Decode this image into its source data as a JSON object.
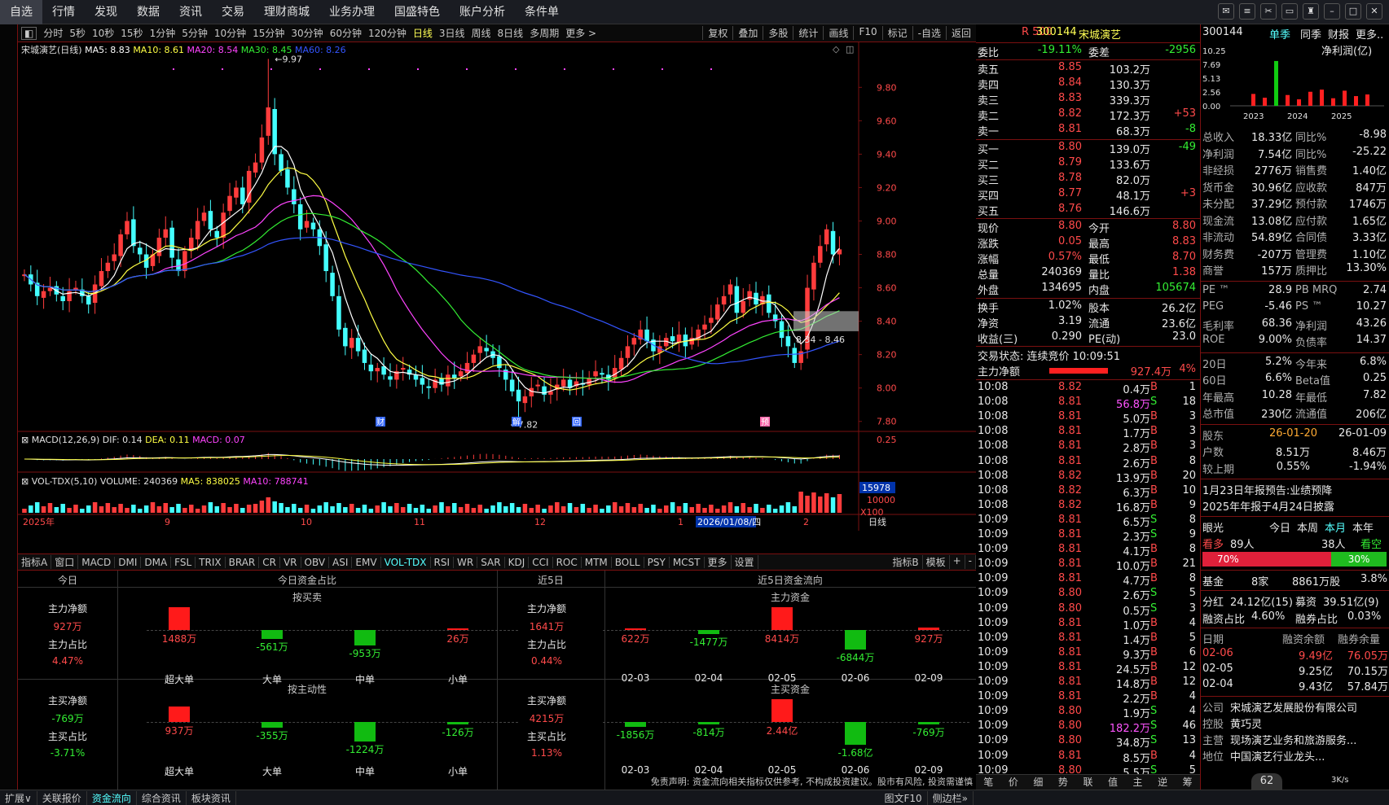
{
  "menu": [
    "自选",
    "行情",
    "发现",
    "数据",
    "资讯",
    "交易",
    "理财商城",
    "业务办理",
    "国盛特色",
    "账户分析",
    "条件单"
  ],
  "periods": [
    "分时",
    "5秒",
    "10秒",
    "15秒",
    "1分钟",
    "5分钟",
    "10分钟",
    "15分钟",
    "30分钟",
    "60分钟",
    "120分钟",
    "日线",
    "3日线",
    "周线",
    "8日线",
    "多周期",
    "更多 >"
  ],
  "period_active": "日线",
  "chart_tools": [
    "复权",
    "叠加",
    "多股",
    "统计",
    "画线",
    "F10",
    "标记",
    "-自选",
    "返回"
  ],
  "stock": {
    "code": "300144",
    "name": "宋城演艺",
    "chart_title": "宋城演艺(日线)",
    "market_tag": "R 500"
  },
  "ma": {
    "ma5": "MA5: 8.83",
    "ma10": "MA10: 8.61",
    "ma20": "MA20: 8.54",
    "ma30": "MA30: 8.45",
    "ma60": "MA60: 8.26"
  },
  "macd_label": {
    "name": "MACD(12,26,9)",
    "dif": "DIF: 0.14",
    "dea": "DEA: 0.11",
    "macd": "MACD: 0.07"
  },
  "vol_label": {
    "name": "VOL-TDX(5,10)",
    "volume": "VOLUME: 240369",
    "ma5": "MA5: 838025",
    "ma10": "MA10: 788741"
  },
  "annotations": {
    "high": "9.97",
    "low": "7.82",
    "range": "8.34 - 8.46",
    "cai": "财",
    "jie": "解",
    "hui": "回",
    "yu": "预"
  },
  "chart_data": {
    "type": "candlestick",
    "y_ticks": [
      "9.80",
      "9.60",
      "9.40",
      "9.20",
      "9.00",
      "8.80",
      "8.60",
      "8.40",
      "8.20",
      "8.00",
      "7.80"
    ],
    "macd_tick": "0.25",
    "vol_ticks": [
      "15978",
      "10000"
    ],
    "vol_unit": "X100",
    "x_labels": [
      "2025年",
      "9",
      "10",
      "11",
      "12",
      "1",
      "2026/01/08/四",
      "2"
    ],
    "x_unit": "日线",
    "ylim": [
      7.75,
      10.05
    ],
    "closes": [
      8.68,
      8.62,
      8.55,
      8.58,
      8.6,
      8.56,
      8.52,
      8.58,
      8.6,
      8.55,
      8.5,
      8.62,
      8.7,
      8.75,
      8.8,
      8.92,
      9.0,
      8.85,
      8.8,
      8.72,
      8.8,
      8.9,
      8.95,
      8.78,
      8.7,
      8.82,
      8.9,
      9.0,
      9.05,
      8.95,
      8.9,
      9.05,
      9.15,
      9.2,
      9.1,
      9.3,
      9.35,
      9.5,
      9.68,
      9.4,
      9.3,
      9.2,
      9.1,
      8.95,
      9.0,
      8.95,
      8.85,
      8.7,
      8.55,
      8.35,
      8.25,
      8.3,
      8.22,
      8.15,
      8.1,
      8.12,
      8.08,
      8.05,
      8.1,
      8.12,
      8.08,
      8.05,
      8.02,
      8.0,
      8.05,
      8.02,
      8.08,
      8.06,
      8.1,
      8.15,
      8.2,
      8.25,
      8.22,
      8.18,
      8.12,
      8.05,
      7.98,
      7.92,
      7.95,
      8.0,
      8.02,
      7.96,
      7.98,
      8.02,
      8.05,
      8.0,
      8.04,
      8.02,
      8.06,
      8.1,
      8.08,
      8.05,
      8.12,
      8.18,
      8.25,
      8.3,
      8.35,
      8.28,
      8.22,
      8.25,
      8.3,
      8.28,
      8.32,
      8.25,
      8.3,
      8.35,
      8.38,
      8.42,
      8.5,
      8.55,
      8.62,
      8.45,
      8.52,
      8.58,
      8.5,
      8.55,
      8.45,
      8.4,
      8.3,
      8.25,
      8.15,
      8.22,
      8.6,
      8.75,
      8.85,
      8.95,
      8.8,
      8.83
    ]
  },
  "quote": {
    "weibi_label": "委比",
    "weibi": "-19.11%",
    "weicha_label": "委差",
    "weicha": "-2956",
    "sells": [
      {
        "label": "卖五",
        "p": "8.85",
        "v": "103.2万",
        "d": ""
      },
      {
        "label": "卖四",
        "p": "8.84",
        "v": "130.3万",
        "d": ""
      },
      {
        "label": "卖三",
        "p": "8.83",
        "v": "339.3万",
        "d": ""
      },
      {
        "label": "卖二",
        "p": "8.82",
        "v": "172.3万",
        "d": "+53"
      },
      {
        "label": "卖一",
        "p": "8.81",
        "v": "68.3万",
        "d": "-8"
      }
    ],
    "buys": [
      {
        "label": "买一",
        "p": "8.80",
        "v": "139.0万",
        "d": "-49"
      },
      {
        "label": "买二",
        "p": "8.79",
        "v": "133.6万",
        "d": ""
      },
      {
        "label": "买三",
        "p": "8.78",
        "v": "82.0万",
        "d": ""
      },
      {
        "label": "买四",
        "p": "8.77",
        "v": "48.1万",
        "d": "+3"
      },
      {
        "label": "买五",
        "p": "8.76",
        "v": "146.6万",
        "d": ""
      }
    ],
    "stats": [
      {
        "a": "现价",
        "av": "8.80",
        "b": "今开",
        "bv": "8.80"
      },
      {
        "a": "涨跌",
        "av": "0.05",
        "b": "最高",
        "bv": "8.83"
      },
      {
        "a": "涨幅",
        "av": "0.57%",
        "b": "最低",
        "bv": "8.70"
      },
      {
        "a": "总量",
        "av": "240369",
        "b": "量比",
        "bv": "1.38"
      },
      {
        "a": "外盘",
        "av": "134695",
        "b": "内盘",
        "bv": "105674"
      }
    ],
    "stats2": [
      {
        "a": "换手",
        "av": "1.02%",
        "b": "股本",
        "bv": "26.2亿"
      },
      {
        "a": "净资",
        "av": "3.19",
        "b": "流通",
        "bv": "23.6亿"
      },
      {
        "a": "收益(三)",
        "av": "0.290",
        "b": "PE(动)",
        "bv": "23.0"
      }
    ],
    "trade_status": "交易状态: 连续竞价 10:09:51",
    "main_net_label": "主力净额",
    "main_net": "927.4万",
    "main_net_pct": "4%"
  },
  "ticks": [
    [
      "10:08",
      "8.82",
      "0.4万",
      "B",
      "1"
    ],
    [
      "10:08",
      "8.81",
      "56.8万",
      "S",
      "18"
    ],
    [
      "10:08",
      "8.81",
      "5.0万",
      "B",
      "3"
    ],
    [
      "10:08",
      "8.81",
      "1.7万",
      "B",
      "3"
    ],
    [
      "10:08",
      "8.81",
      "2.8万",
      "B",
      "3"
    ],
    [
      "10:08",
      "8.81",
      "2.6万",
      "B",
      "8"
    ],
    [
      "10:08",
      "8.82",
      "13.9万",
      "B",
      "20"
    ],
    [
      "10:08",
      "8.82",
      "6.3万",
      "B",
      "10"
    ],
    [
      "10:08",
      "8.82",
      "16.8万",
      "B",
      "9"
    ],
    [
      "10:09",
      "8.81",
      "6.5万",
      "S",
      "8"
    ],
    [
      "10:09",
      "8.81",
      "2.3万",
      "S",
      "9"
    ],
    [
      "10:09",
      "8.81",
      "4.1万",
      "B",
      "8"
    ],
    [
      "10:09",
      "8.81",
      "10.0万",
      "B",
      "21"
    ],
    [
      "10:09",
      "8.81",
      "4.7万",
      "B",
      "8"
    ],
    [
      "10:09",
      "8.80",
      "2.6万",
      "S",
      "5"
    ],
    [
      "10:09",
      "8.80",
      "0.5万",
      "S",
      "3"
    ],
    [
      "10:09",
      "8.81",
      "1.0万",
      "B",
      "4"
    ],
    [
      "10:09",
      "8.81",
      "1.4万",
      "B",
      "5"
    ],
    [
      "10:09",
      "8.81",
      "9.3万",
      "B",
      "6"
    ],
    [
      "10:09",
      "8.81",
      "24.5万",
      "B",
      "12"
    ],
    [
      "10:09",
      "8.81",
      "14.8万",
      "B",
      "12"
    ],
    [
      "10:09",
      "8.81",
      "2.2万",
      "B",
      "4"
    ],
    [
      "10:09",
      "8.80",
      "1.9万",
      "S",
      "4"
    ],
    [
      "10:09",
      "8.80",
      "182.2万",
      "S",
      "46"
    ],
    [
      "10:09",
      "8.80",
      "34.8万",
      "S",
      "13"
    ],
    [
      "10:09",
      "8.81",
      "8.5万",
      "B",
      "4"
    ],
    [
      "10:09",
      "8.80",
      "5.5万",
      "S",
      "5"
    ]
  ],
  "tick_bottom": [
    "笔",
    "价",
    "细",
    "势",
    "联",
    "值",
    "主",
    "逆",
    "筹"
  ],
  "f10": {
    "code": "300144",
    "tabs": [
      "单季",
      "同季",
      "财报",
      "更多.."
    ],
    "net_profit_label": "净利润(亿)",
    "y_ticks": [
      "10.25",
      "7.69",
      "5.13",
      "2.56",
      "0.00"
    ],
    "years": [
      "2023",
      "2024",
      "2025"
    ],
    "profit_bars": [
      2.2,
      1.5,
      8.3,
      2.0,
      1.2,
      2.6,
      3.0,
      1.4,
      2.8,
      1.8,
      2.1
    ],
    "fin": [
      [
        "总收入",
        "18.33亿",
        "同比%",
        "-8.98"
      ],
      [
        "净利润",
        "7.54亿",
        "同比%",
        "-25.22"
      ],
      [
        "非经损",
        "2776万",
        "销售费",
        "1.40亿"
      ],
      [
        "货币金",
        "30.96亿",
        "应收款",
        "847万"
      ],
      [
        "未分配",
        "37.29亿",
        "预付款",
        "1746万"
      ],
      [
        "现金流",
        "13.08亿",
        "应付款",
        "1.65亿"
      ],
      [
        "非流动",
        "54.89亿",
        "合同债",
        "3.33亿"
      ],
      [
        "财务费",
        "-207万",
        "管理费",
        "1.10亿"
      ],
      [
        "商誉",
        "157万",
        "质押比",
        "13.30%"
      ]
    ],
    "val": [
      [
        "PE ™",
        "28.9",
        "PB MRQ",
        "2.74"
      ],
      [
        "PEG",
        "-5.46",
        "PS ™",
        "10.27"
      ],
      [
        "毛利率",
        "68.36",
        "净利润",
        "43.26"
      ],
      [
        "ROE",
        "9.00%",
        "负债率",
        "14.37"
      ]
    ],
    "perf": [
      [
        "20日",
        "5.2%",
        "今年来",
        "6.8%"
      ],
      [
        "60日",
        "6.6%",
        "Beta值",
        "0.25"
      ],
      [
        "年最高",
        "10.28",
        "年最低",
        "7.82"
      ],
      [
        "总市值",
        "230亿",
        "流通值",
        "206亿"
      ]
    ],
    "holders": [
      [
        "股东",
        "26-01-20",
        "26-01-09"
      ],
      [
        "户数",
        "8.51万",
        "8.46万"
      ],
      [
        "较上期",
        "0.55%",
        "-1.94%"
      ]
    ],
    "notices": [
      "1月23日年报预告:业绩预降",
      "2025年年报于4月24日披露"
    ],
    "vision": {
      "label": "眼光",
      "tabs": [
        "今日",
        "本周",
        "本月",
        "本年"
      ],
      "bear_label": "看多",
      "bear_cnt": "89人",
      "bull_cnt": "38人",
      "bull_label": "看空",
      "pct_a": "70%",
      "pct_b": "30%",
      "pct_a_val": 70
    },
    "fund": [
      "基金",
      "8家",
      "8861万股",
      "3.8%"
    ],
    "div": [
      "分红",
      "24.12亿(15)",
      "募资",
      "39.51亿(9)"
    ],
    "margin": [
      "融资占比",
      "4.60%",
      "融券占比",
      "0.03%"
    ],
    "margin_head": [
      "日期",
      "融资余额",
      "融券余量"
    ],
    "margin_rows": [
      [
        "02-06",
        "9.49亿",
        "76.05万"
      ],
      [
        "02-05",
        "9.25亿",
        "70.15万"
      ],
      [
        "02-04",
        "9.43亿",
        "57.84万"
      ]
    ],
    "company": [
      [
        "公司",
        "宋城演艺发展股份有限公司"
      ],
      [
        "控股",
        "黄巧灵"
      ],
      [
        "主营",
        "现场演艺业务和旅游服务..."
      ],
      [
        "地位",
        "中国演艺行业龙头..."
      ]
    ]
  },
  "indicators": [
    "指标A",
    "窗口",
    "MACD",
    "DMI",
    "DMA",
    "FSL",
    "TRIX",
    "BRAR",
    "CR",
    "VR",
    "OBV",
    "ASI",
    "EMV",
    "VOL-TDX",
    "RSI",
    "WR",
    "SAR",
    "KDJ",
    "CCI",
    "ROC",
    "MTM",
    "BOLL",
    "PSY",
    "MCST",
    "更多",
    "设置"
  ],
  "indicator_active": "VOL-TDX",
  "indicator_right": [
    "指标B",
    "模板",
    "+",
    "-"
  ],
  "flow": {
    "today": "今日",
    "today_share": "今日资金占比",
    "d5": "近5日",
    "d5_flow": "近5日资金流向",
    "by_bs": "按买卖",
    "by_act": "按主动性",
    "main_fund": "主力资金",
    "main_buy": "主买资金",
    "left1": [
      [
        "主力净额",
        "927万"
      ],
      [
        "主力占比",
        "4.47%"
      ]
    ],
    "left2": [
      [
        "主买净额",
        "-769万"
      ],
      [
        "主买占比",
        "-3.71%"
      ]
    ],
    "mid1": [
      [
        "主力净额",
        "1641万"
      ],
      [
        "主力占比",
        "0.44%"
      ]
    ],
    "mid2": [
      [
        "主买净额",
        "4215万"
      ],
      [
        "主买占比",
        "1.13%"
      ]
    ],
    "sizes": [
      "超大单",
      "大单",
      "中单",
      "小单"
    ],
    "bars1": [
      {
        "v": "1488万",
        "h": 1488
      },
      {
        "v": "-561万",
        "h": -561
      },
      {
        "v": "-953万",
        "h": -953
      },
      {
        "v": "26万",
        "h": 26
      }
    ],
    "bars2": [
      {
        "v": "937万",
        "h": 937
      },
      {
        "v": "-355万",
        "h": -355
      },
      {
        "v": "-1224万",
        "h": -1224
      },
      {
        "v": "-126万",
        "h": -126
      }
    ],
    "dates": [
      "02-03",
      "02-04",
      "02-05",
      "02-06",
      "02-09"
    ],
    "bars3": [
      {
        "v": "622万",
        "h": 622
      },
      {
        "v": "-1477万",
        "h": -1477
      },
      {
        "v": "8414万",
        "h": 8414
      },
      {
        "v": "-6844万",
        "h": -6844
      },
      {
        "v": "927万",
        "h": 927
      }
    ],
    "bars4": [
      {
        "v": "-1856万",
        "h": -1856
      },
      {
        "v": "-814万",
        "h": -814
      },
      {
        "v": "2.44亿",
        "h": 24400
      },
      {
        "v": "-1.68亿",
        "h": -16800
      },
      {
        "v": "-769万",
        "h": -769
      }
    ],
    "disclaimer": "免责声明: 资金流向相关指标仅供参考, 不构成投资建议。股市有风险, 投资需谨慎"
  },
  "bottom": [
    "扩展∨",
    "关联报价",
    "资金流向",
    "综合资讯",
    "板块资讯"
  ],
  "bottom_active": "资金流向",
  "bottom_right": [
    "图文F10",
    "侧边栏»"
  ],
  "badge": "62",
  "speed": "3K/s"
}
